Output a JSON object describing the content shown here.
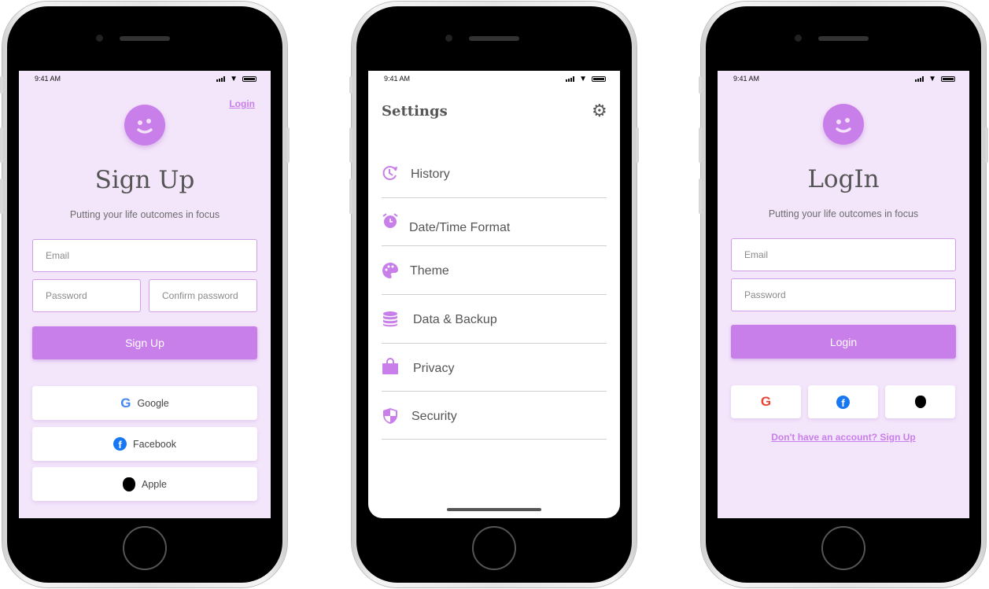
{
  "status_bar": {
    "time": "9:41 AM"
  },
  "signup": {
    "login_link": "Login",
    "title": "Sign Up",
    "subtitle": "Putting your life outcomes in focus",
    "email_placeholder": "Email",
    "password_placeholder": "Password",
    "confirm_placeholder": "Confirm password",
    "submit_label": "Sign Up",
    "google_label": "Google",
    "facebook_label": "Facebook",
    "apple_label": "Apple"
  },
  "settings": {
    "title": "Settings",
    "items": [
      {
        "label": "History",
        "icon": "history-icon"
      },
      {
        "label": "Date/Time Format",
        "icon": "alarm-clock-icon"
      },
      {
        "label": "Theme",
        "icon": "palette-icon"
      },
      {
        "label": "Data & Backup",
        "icon": "database-icon"
      },
      {
        "label": "Privacy",
        "icon": "bag-icon"
      },
      {
        "label": "Security",
        "icon": "shield-icon"
      }
    ]
  },
  "login": {
    "title": "LogIn",
    "subtitle": "Putting your life outcomes in focus",
    "email_placeholder": "Email",
    "password_placeholder": "Password",
    "submit_label": "Login",
    "signup_link": "Don't have an account? Sign Up"
  },
  "colors": {
    "accent": "#c97fe9",
    "screen_bg": "#f3e5fa",
    "text": "#555555"
  }
}
